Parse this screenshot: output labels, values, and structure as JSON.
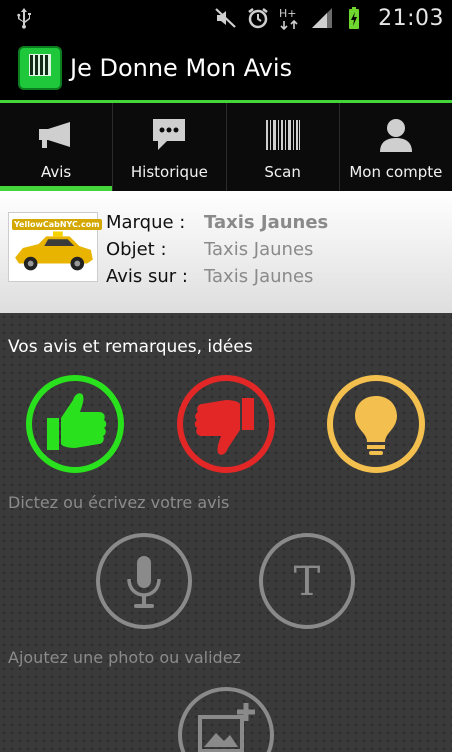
{
  "status_bar": {
    "time": "21:03",
    "network_type": "H+",
    "icons": [
      "usb-icon",
      "mute-icon",
      "alarm-icon",
      "network-type-icon",
      "signal-icon",
      "battery-charging-icon"
    ]
  },
  "app": {
    "title": "Je Donne Mon Avis",
    "logo_icon": "app-logo-qr-icon",
    "accent_color": "#43d53a"
  },
  "tabs": [
    {
      "label": "Avis",
      "icon": "megaphone-icon",
      "active": true
    },
    {
      "label": "Historique",
      "icon": "chat-bubble-icon",
      "active": false
    },
    {
      "label": "Scan",
      "icon": "barcode-icon",
      "active": false
    },
    {
      "label": "Mon compte",
      "icon": "user-icon",
      "active": false
    }
  ],
  "product": {
    "image_icon": "taxi-image",
    "rows": [
      {
        "key": "Marque :",
        "value": "Taxis Jaunes"
      },
      {
        "key": "Objet :",
        "value": "Taxis Jaunes"
      },
      {
        "key": "Avis sur :",
        "value": "Taxis Jaunes"
      }
    ]
  },
  "main": {
    "feedback_title": "Vos avis et remarques, idées",
    "feedback_buttons": [
      {
        "icon": "thumbs-up-icon",
        "color": "#29e21d"
      },
      {
        "icon": "thumbs-down-icon",
        "color": "#e32727"
      },
      {
        "icon": "lightbulb-icon",
        "color": "#f3bf4e"
      }
    ],
    "dictate_label": "Dictez ou écrivez votre avis",
    "input_buttons": [
      {
        "icon": "microphone-icon"
      },
      {
        "icon": "text-icon",
        "glyph": "T"
      }
    ],
    "photo_label": "Ajoutez une photo ou validez",
    "photo_button": {
      "icon": "add-photo-icon"
    }
  }
}
